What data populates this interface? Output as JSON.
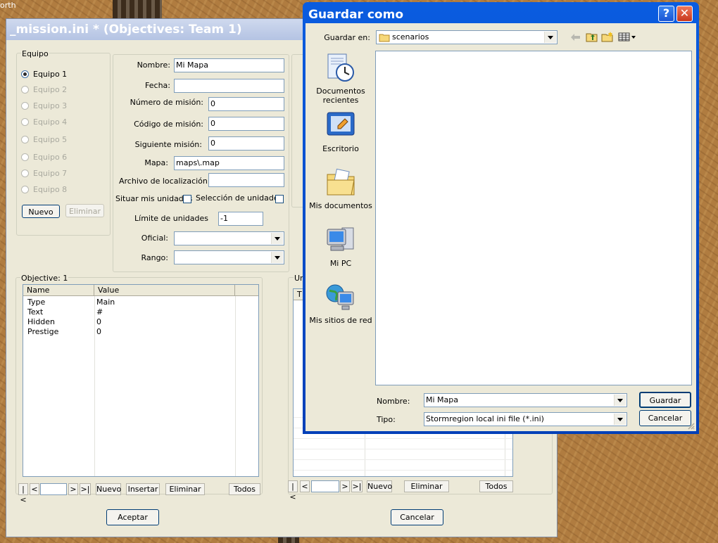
{
  "background": {
    "corner_text": "orth"
  },
  "mission_window": {
    "title": "_mission.ini * (Objectives: Team 1)",
    "team_group": {
      "legend": "Equipo",
      "teams": [
        "Equipo 1",
        "Equipo 2",
        "Equipo 3",
        "Equipo 4",
        "Equipo 5",
        "Equipo 6",
        "Equipo 7",
        "Equipo 8"
      ],
      "selected": "Equipo 1",
      "new_button": "Nuevo",
      "delete_button": "Eliminar"
    },
    "fields": {
      "name_label": "Nombre:",
      "name_value": "Mi Mapa",
      "date_label": "Fecha:",
      "date_value": "",
      "mission_number_label": "Número de misión:",
      "mission_number_value": "0",
      "mission_code_label": "Código de misión:",
      "mission_code_value": "0",
      "next_mission_label": "Siguiente misión:",
      "next_mission_value": "0",
      "map_label": "Mapa:",
      "map_value": "maps\\.map",
      "localization_label": "Archivo de localización:",
      "localization_value": "",
      "place_units_label": "Situar mis unidades",
      "unit_selection_label": "Selección de unidades",
      "unit_limit_label": "Límite de unidades",
      "unit_limit_value": "-1",
      "officer_label": "Oficial:",
      "officer_value": "",
      "rank_label": "Rango:",
      "rank_value": ""
    },
    "objective_group": {
      "legend": "Objective: 1",
      "columns": [
        "Name",
        "Value"
      ],
      "rows": [
        {
          "name": "Type",
          "value": "Main"
        },
        {
          "name": "Text",
          "value": "#"
        },
        {
          "name": "Hidden",
          "value": "0"
        },
        {
          "name": "Prestige",
          "value": "0"
        }
      ],
      "nav": {
        "first": "|<",
        "prev": "<",
        "next": ">",
        "last": ">|"
      },
      "buttons": {
        "new": "Nuevo",
        "insert": "Insertar",
        "delete": "Eliminar",
        "all": "Todos"
      }
    },
    "units_group": {
      "legend": "Un",
      "first_col_header": "T",
      "nav": {
        "first": "|<",
        "prev": "<",
        "next": ">",
        "last": ">|"
      },
      "buttons": {
        "new": "Nuevo",
        "delete": "Eliminar",
        "all": "Todos"
      }
    },
    "accept_button": "Aceptar",
    "cancel_button": "Cancelar"
  },
  "save_dialog": {
    "title": "Guardar como",
    "help_glyph": "?",
    "close_glyph": "✕",
    "save_in_label": "Guardar en:",
    "save_in_value": "scenarios",
    "places": [
      {
        "label": "Documentos recientes",
        "icon": "recent-documents-icon"
      },
      {
        "label": "Escritorio",
        "icon": "desktop-icon"
      },
      {
        "label": "Mis documentos",
        "icon": "my-documents-icon"
      },
      {
        "label": "Mi PC",
        "icon": "my-computer-icon"
      },
      {
        "label": "Mis sitios de red",
        "icon": "network-places-icon"
      }
    ],
    "file_name_label": "Nombre:",
    "file_name_value": "Mi Mapa",
    "file_type_label": "Tipo:",
    "file_type_value": "Stormregion local ini file (*.ini)",
    "save_button": "Guardar",
    "cancel_button": "Cancelar",
    "colors": {
      "titlebar": "#0a5ce0",
      "close_button": "#e0492c"
    }
  }
}
